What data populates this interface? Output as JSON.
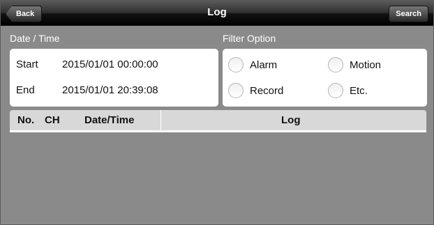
{
  "navbar": {
    "title": "Log",
    "back_label": "Back",
    "search_label": "Search"
  },
  "datetime": {
    "section_label": "Date / Time",
    "start_label": "Start",
    "start_value": "2015/01/01 00:00:00",
    "end_label": "End",
    "end_value": "2015/01/01 20:39:08"
  },
  "filter": {
    "section_label": "Filter Option",
    "options": [
      {
        "label": "Alarm"
      },
      {
        "label": "Motion"
      },
      {
        "label": "Record"
      },
      {
        "label": "Etc."
      }
    ]
  },
  "table": {
    "columns": [
      "No.",
      "CH",
      "Date/Time",
      "Log"
    ],
    "rows": []
  }
}
